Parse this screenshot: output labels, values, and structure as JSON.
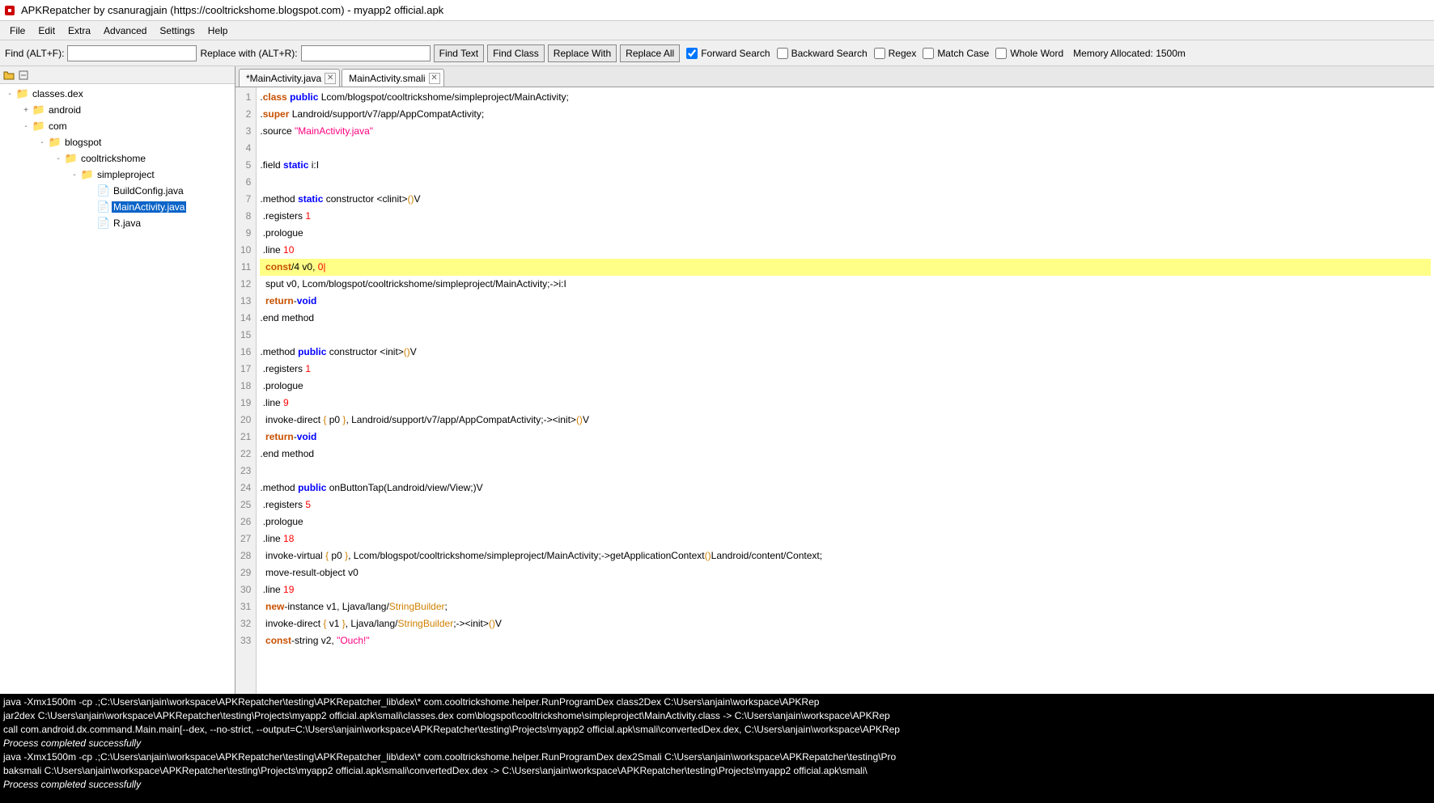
{
  "title": "APKRepatcher by csanuragjain (https://cooltrickshome.blogspot.com) - myapp2 official.apk",
  "menu": [
    "File",
    "Edit",
    "Extra",
    "Advanced",
    "Settings",
    "Help"
  ],
  "toolbar": {
    "find_label": "Find (ALT+F):",
    "replace_label": "Replace with (ALT+R):",
    "find_text_btn": "Find Text",
    "find_class_btn": "Find Class",
    "replace_with_btn": "Replace With",
    "replace_all_btn": "Replace All",
    "forward_search": "Forward Search",
    "backward_search": "Backward Search",
    "regex": "Regex",
    "match_case": "Match Case",
    "whole_word": "Whole Word",
    "memory": "Memory Allocated: 1500m"
  },
  "tree": [
    {
      "indent": 0,
      "toggle": "-",
      "icon": "folder",
      "label": "classes.dex"
    },
    {
      "indent": 1,
      "toggle": "+",
      "icon": "folder",
      "label": "android"
    },
    {
      "indent": 1,
      "toggle": "-",
      "icon": "folder",
      "label": "com"
    },
    {
      "indent": 2,
      "toggle": "-",
      "icon": "folder",
      "label": "blogspot"
    },
    {
      "indent": 3,
      "toggle": "-",
      "icon": "folder",
      "label": "cooltrickshome"
    },
    {
      "indent": 4,
      "toggle": "-",
      "icon": "folder",
      "label": "simpleproject"
    },
    {
      "indent": 5,
      "toggle": "",
      "icon": "file",
      "label": "BuildConfig.java"
    },
    {
      "indent": 5,
      "toggle": "",
      "icon": "file",
      "label": "MainActivity.java",
      "selected": true
    },
    {
      "indent": 5,
      "toggle": "",
      "icon": "file",
      "label": "R.java"
    }
  ],
  "tabs": [
    {
      "label": "*MainActivity.java",
      "active": false
    },
    {
      "label": "MainActivity.smali",
      "active": true
    }
  ],
  "code": {
    "lines": [
      {
        "n": 1,
        "html": ".<span class='kw-class'>class</span> <span class='kw-public'>public</span> Lcom/blogspot/cooltrickshome/simpleproject/MainActivity;"
      },
      {
        "n": 2,
        "html": ".<span class='kw-super'>super</span> Landroid/support/v7/app/AppCompatActivity;"
      },
      {
        "n": 3,
        "html": ".source <span class='str'>\"MainActivity.java\"</span>"
      },
      {
        "n": 4,
        "html": ""
      },
      {
        "n": 5,
        "html": ".field <span class='kw-static'>static</span> i:I"
      },
      {
        "n": 6,
        "html": ""
      },
      {
        "n": 7,
        "html": ".method <span class='kw-static'>static</span> constructor &lt;clinit&gt;<span class='paren'>()</span>V"
      },
      {
        "n": 8,
        "html": " .registers <span class='num'>1</span>"
      },
      {
        "n": 9,
        "html": " .prologue"
      },
      {
        "n": 10,
        "html": " .line <span class='num'>10</span>"
      },
      {
        "n": 11,
        "html": "  <span class='kw-const'>const</span>/4 v0, <span class='num'>0|</span>",
        "hl": true
      },
      {
        "n": 12,
        "html": "  sput v0, Lcom/blogspot/cooltrickshome/simpleproject/MainActivity;-&gt;i:I"
      },
      {
        "n": 13,
        "html": "  <span class='kw-return'>return</span>-<span class='kw-void'>void</span>"
      },
      {
        "n": 14,
        "html": ".end method"
      },
      {
        "n": 15,
        "html": ""
      },
      {
        "n": 16,
        "html": ".method <span class='kw-public'>public</span> constructor &lt;init&gt;<span class='paren'>()</span>V"
      },
      {
        "n": 17,
        "html": " .registers <span class='num'>1</span>"
      },
      {
        "n": 18,
        "html": " .prologue"
      },
      {
        "n": 19,
        "html": " .line <span class='num'>9</span>"
      },
      {
        "n": 20,
        "html": "  invoke-direct <span class='paren'>{</span> p0 <span class='paren'>}</span>, Landroid/support/v7/app/AppCompatActivity;-&gt;&lt;init&gt;<span class='paren'>()</span>V"
      },
      {
        "n": 21,
        "html": "  <span class='kw-return'>return</span>-<span class='kw-void'>void</span>"
      },
      {
        "n": 22,
        "html": ".end method"
      },
      {
        "n": 23,
        "html": ""
      },
      {
        "n": 24,
        "html": ".method <span class='kw-public'>public</span> onButtonTap(Landroid/view/View;)V"
      },
      {
        "n": 25,
        "html": " .registers <span class='num'>5</span>"
      },
      {
        "n": 26,
        "html": " .prologue"
      },
      {
        "n": 27,
        "html": " .line <span class='num'>18</span>"
      },
      {
        "n": 28,
        "html": "  invoke-virtual <span class='paren'>{</span> p0 <span class='paren'>}</span>, Lcom/blogspot/cooltrickshome/simpleproject/MainActivity;-&gt;getApplicationContext<span class='paren'>()</span>Landroid/content/Context;"
      },
      {
        "n": 29,
        "html": "  move-result-object v0"
      },
      {
        "n": 30,
        "html": " .line <span class='num'>19</span>"
      },
      {
        "n": 31,
        "html": "  <span class='kw-new'>new</span>-instance v1, Ljava/lang/<span class='type'>StringBuilder</span>;"
      },
      {
        "n": 32,
        "html": "  invoke-direct <span class='paren'>{</span> v1 <span class='paren'>}</span>, Ljava/lang/<span class='type'>StringBuilder</span>;-&gt;&lt;init&gt;<span class='paren'>()</span>V"
      },
      {
        "n": 33,
        "html": "  <span class='kw-const'>const</span>-string v2, <span class='str'>\"Ouch!\"</span>"
      }
    ]
  },
  "console": [
    "java -Xmx1500m -cp .;C:\\Users\\anjain\\workspace\\APKRepatcher\\testing\\APKRepatcher_lib\\dex\\* com.cooltrickshome.helper.RunProgramDex class2Dex C:\\Users\\anjain\\workspace\\APKRep",
    "jar2dex C:\\Users\\anjain\\workspace\\APKRepatcher\\testing\\Projects\\myapp2 official.apk\\smali\\classes.dex com\\blogspot\\cooltrickshome\\simpleproject\\MainActivity.class -> C:\\Users\\anjain\\workspace\\APKRep",
    "call com.android.dx.command.Main.main[--dex, --no-strict, --output=C:\\Users\\anjain\\workspace\\APKRepatcher\\testing\\Projects\\myapp2 official.apk\\smali\\convertedDex.dex, C:\\Users\\anjain\\workspace\\APKRep",
    "Process completed successfully",
    "java -Xmx1500m -cp .;C:\\Users\\anjain\\workspace\\APKRepatcher\\testing\\APKRepatcher_lib\\dex\\* com.cooltrickshome.helper.RunProgramDex dex2Smali C:\\Users\\anjain\\workspace\\APKRepatcher\\testing\\Pro",
    "baksmali C:\\Users\\anjain\\workspace\\APKRepatcher\\testing\\Projects\\myapp2 official.apk\\smali\\convertedDex.dex -> C:\\Users\\anjain\\workspace\\APKRepatcher\\testing\\Projects\\myapp2 official.apk\\smali\\",
    "Process completed successfully"
  ]
}
